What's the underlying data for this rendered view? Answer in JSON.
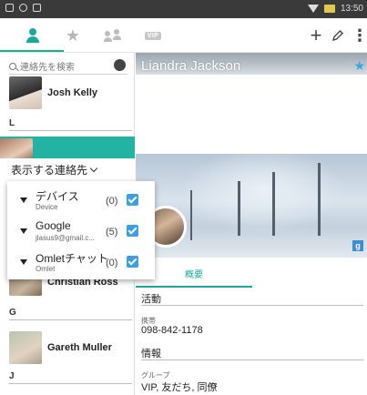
{
  "status_bar": {
    "time": "13:50"
  },
  "toolbar": {
    "vip_label": "VIP",
    "add_glyph": "+",
    "more_glyph": "⋮"
  },
  "search": {
    "placeholder": "連絡先を検索"
  },
  "contacts": {
    "josh": "Josh Kelly",
    "section_L": "L",
    "chris": "Christian Ross",
    "section_G": "G",
    "gareth": "Gareth Muller",
    "section_J": "J"
  },
  "accounts_menu": {
    "header": "表示する連絡先",
    "items": [
      {
        "name": "デバイス",
        "sub": "Device",
        "count": "(0)"
      },
      {
        "name": "Google",
        "sub": "jlasus9@gmail.c...",
        "count": "(5)"
      },
      {
        "name": "Omletチャット",
        "sub": "Omlet",
        "count": "(0)"
      }
    ]
  },
  "detail": {
    "name": "Liandra Jackson",
    "tab_overview": "概要",
    "section_activity": "活動",
    "mobile_label": "携帯",
    "mobile_value": "098-842-1178",
    "section_info": "情報",
    "group_label": "グループ",
    "group_value": "VIP, 友だち, 同僚",
    "gplus": "g"
  },
  "colors": {
    "accent": "#1aa99a",
    "checkbox": "#3c9fe0",
    "selected_row": "#22b3a2"
  }
}
